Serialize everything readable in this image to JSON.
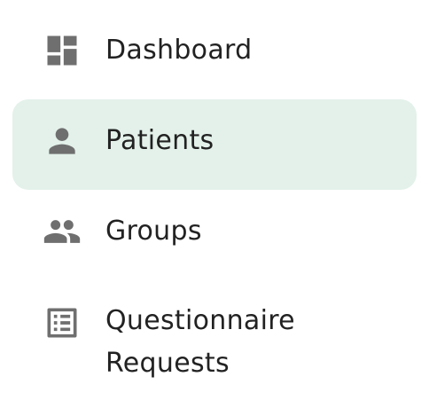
{
  "nav": {
    "items": [
      {
        "label": "Dashboard",
        "icon": "dashboard-icon",
        "active": false
      },
      {
        "label": "Patients",
        "icon": "person-icon",
        "active": true
      },
      {
        "label": "Groups",
        "icon": "group-icon",
        "active": false
      },
      {
        "label": "Questionnaire\nRequests",
        "icon": "list-icon",
        "active": false
      }
    ],
    "colors": {
      "active_bg": "#e3f1ea",
      "icon": "#6f6f6f",
      "text": "#222222"
    }
  }
}
